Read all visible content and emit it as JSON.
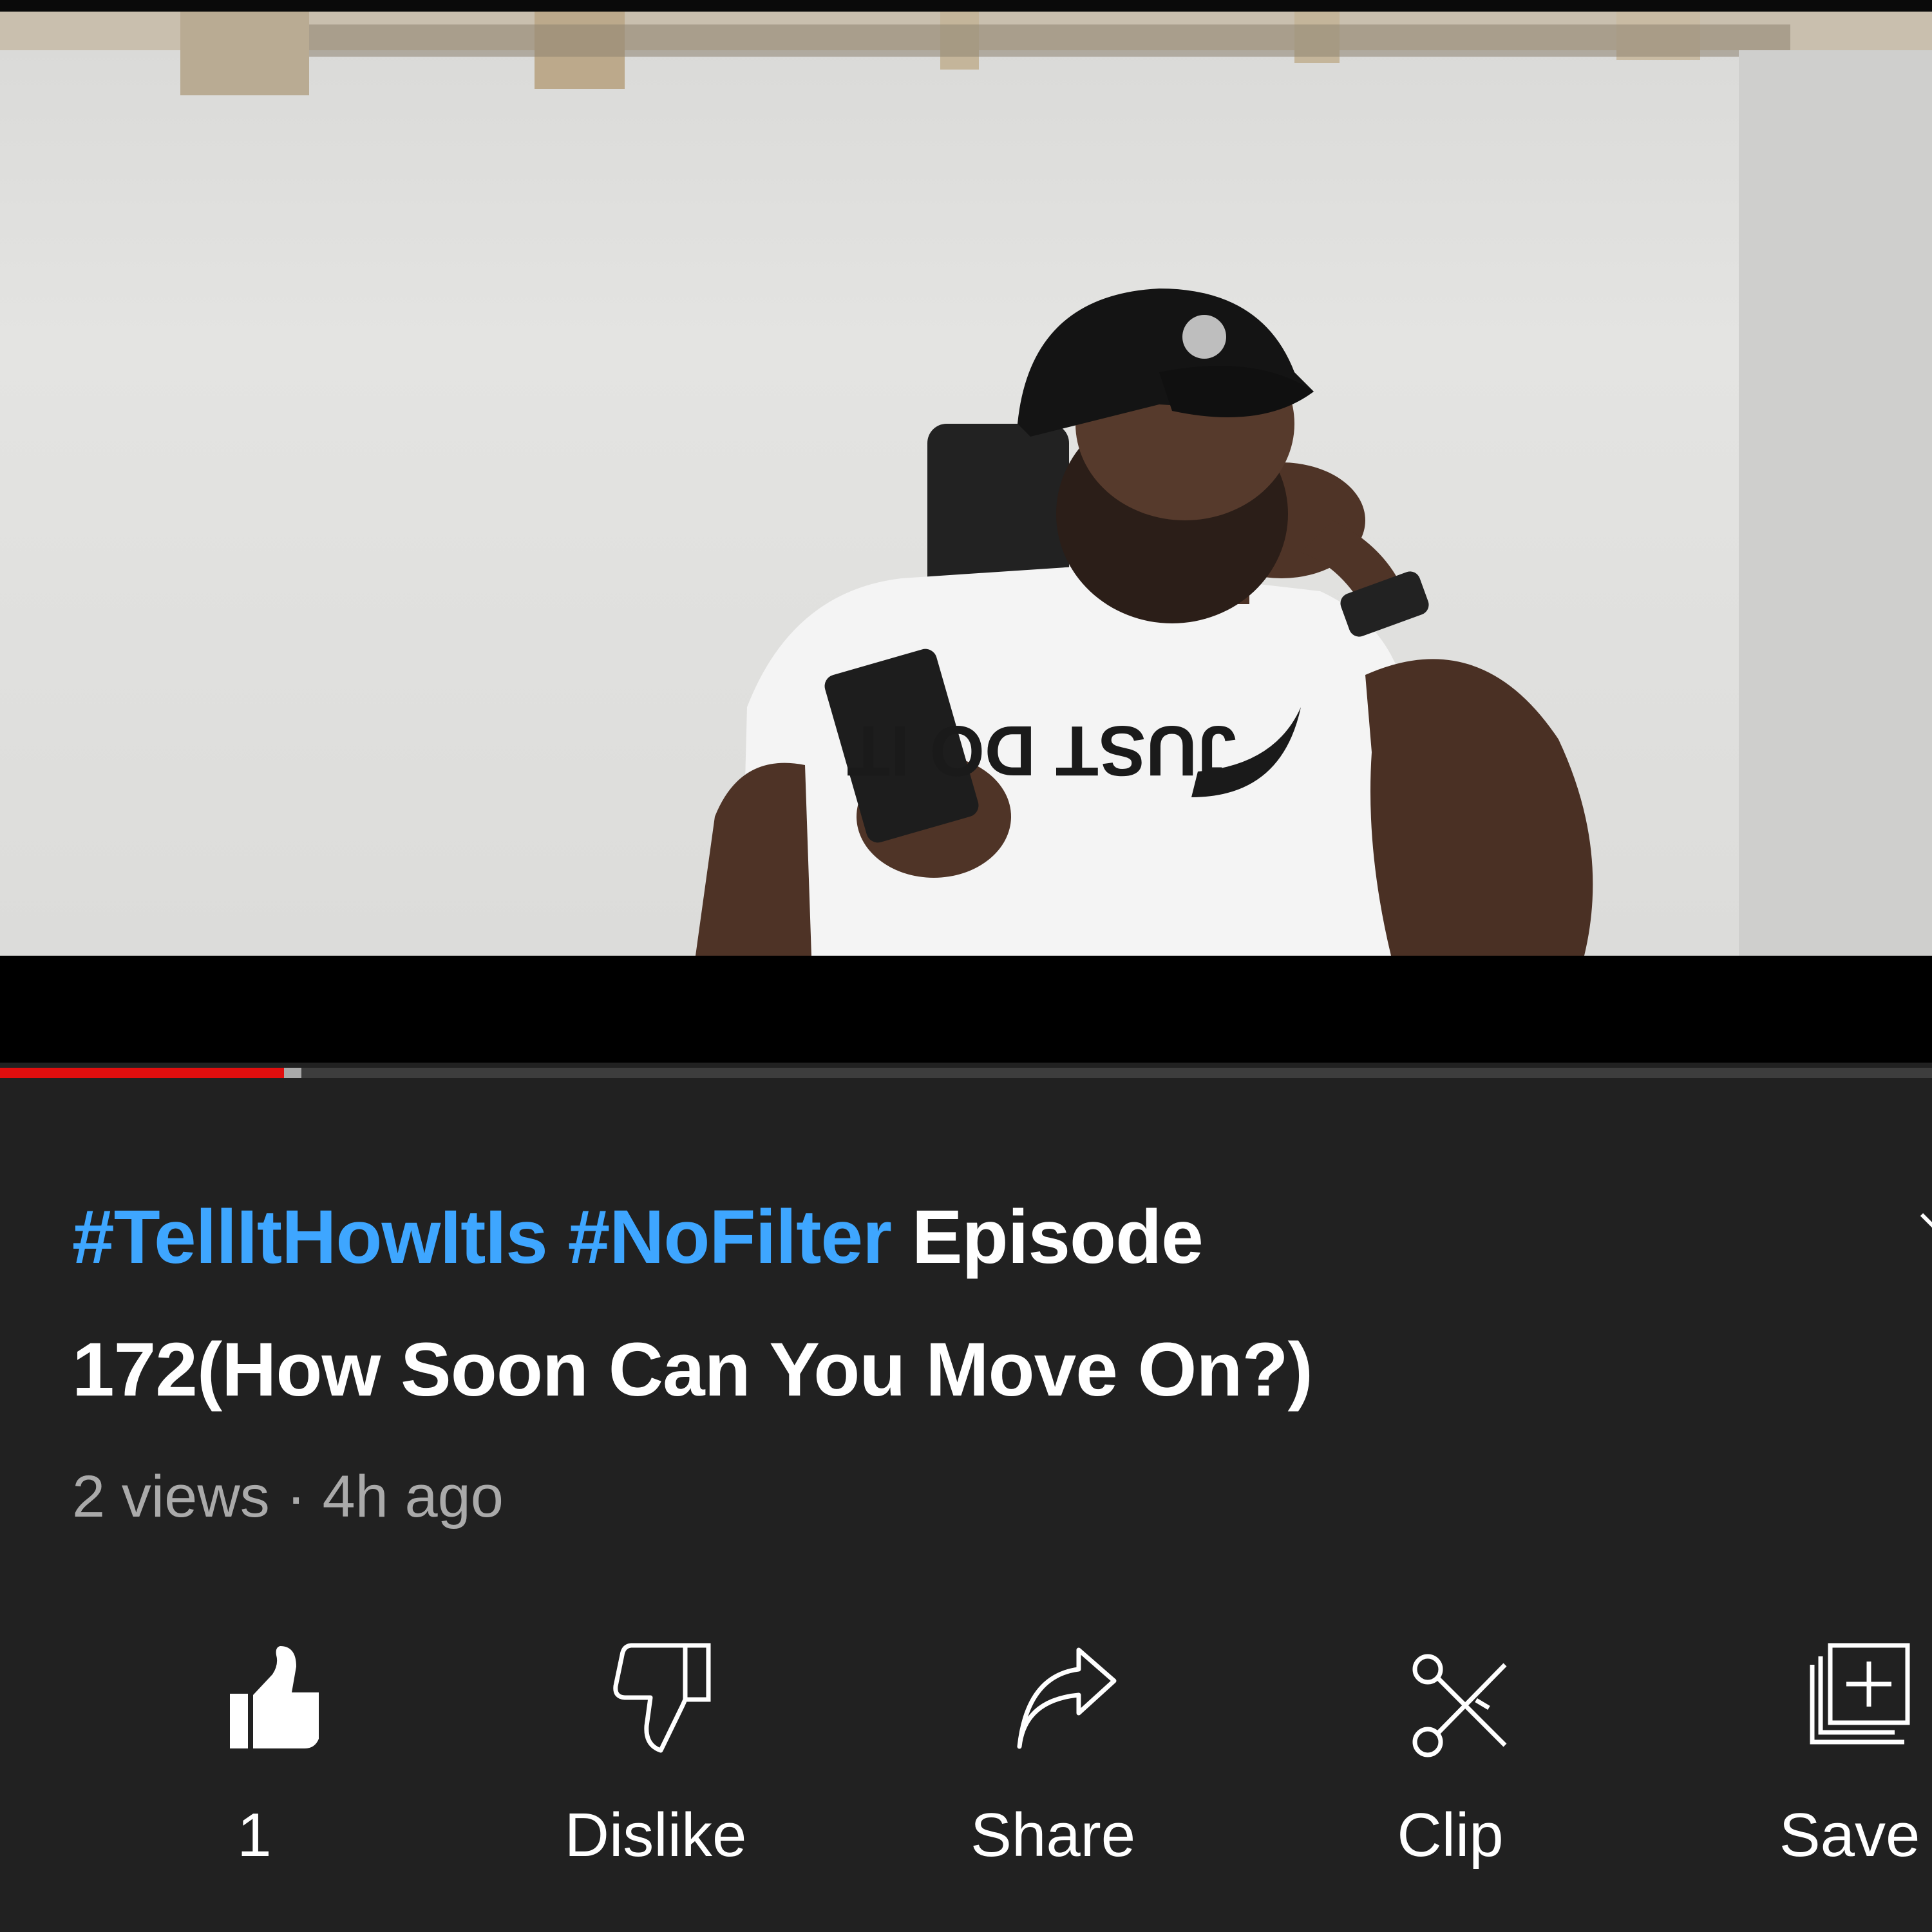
{
  "video": {
    "shirt_text": "JUST DO IT",
    "progress_percent": 14.7,
    "buffered_percent": 15.6,
    "colors": {
      "played": "#e00e0e",
      "buffered": "#a9a9a9",
      "track": "#3d3d3d"
    }
  },
  "title": {
    "hashtag1": "#TellItHowItIs",
    "hashtag2": "#NoFilter",
    "line1_rest": "Episode",
    "line2": "172(How Soon Can You Move On?)"
  },
  "meta": {
    "views": "2 views",
    "separator": "·",
    "age": "4h ago"
  },
  "actions": {
    "like": {
      "label": "1",
      "icon": "thumbs-up-filled-icon"
    },
    "dislike": {
      "label": "Dislike",
      "icon": "thumbs-down-icon"
    },
    "share": {
      "label": "Share",
      "icon": "share-arrow-icon"
    },
    "clip": {
      "label": "Clip",
      "icon": "scissors-icon"
    },
    "save": {
      "label": "Save",
      "icon": "playlist-add-icon"
    }
  },
  "colors": {
    "background": "#212121",
    "hashtag": "#3ea6ff",
    "text": "#ffffff",
    "secondary": "#aaaaaa"
  }
}
